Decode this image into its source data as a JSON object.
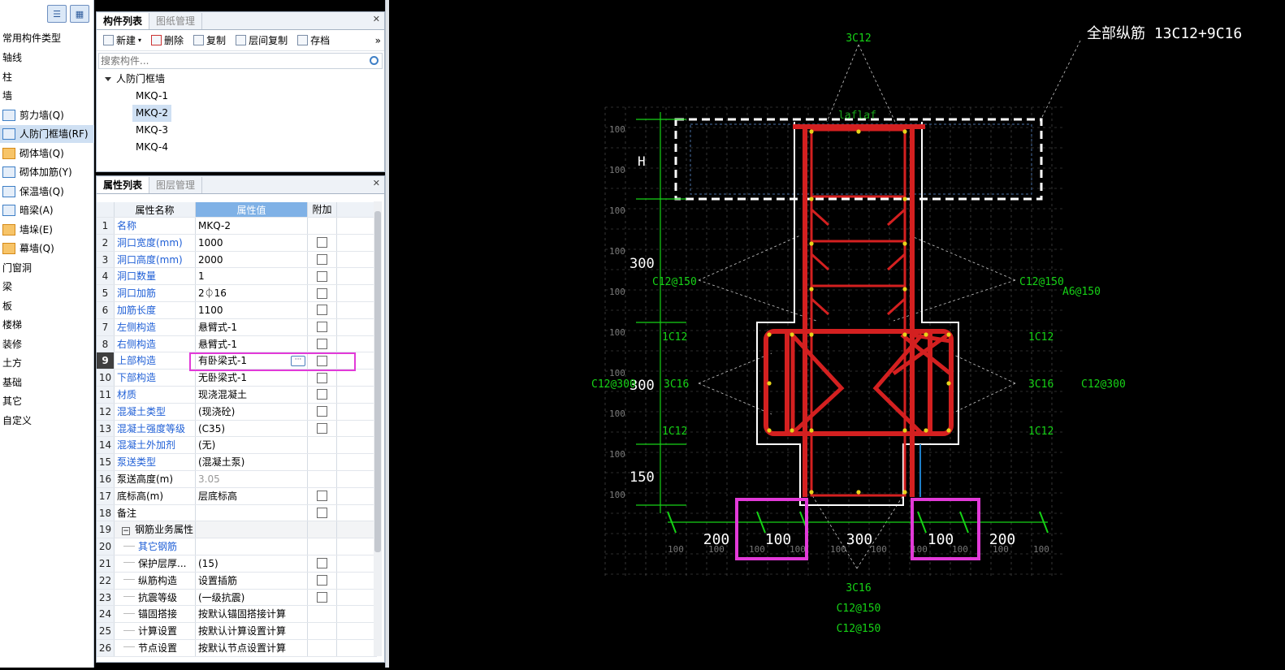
{
  "nav": {
    "title": "常用构件类型",
    "items": [
      {
        "label": "轴线"
      },
      {
        "label": "柱"
      },
      {
        "label": "墙"
      },
      {
        "label": "剪力墙(Q)",
        "icon": "shear-wall-icon"
      },
      {
        "label": "人防门框墙(RF)",
        "icon": "door-frame-wall-icon"
      },
      {
        "label": "砌体墙(Q)",
        "icon": "masonry-wall-icon"
      },
      {
        "label": "砌体加筋(Y)",
        "icon": "masonry-rebar-icon"
      },
      {
        "label": "保温墙(Q)",
        "icon": "insulation-wall-icon"
      },
      {
        "label": "暗梁(A)",
        "icon": "hidden-beam-icon"
      },
      {
        "label": "墙垛(E)",
        "icon": "wall-pier-icon"
      },
      {
        "label": "幕墙(Q)",
        "icon": "curtain-wall-icon"
      },
      {
        "label": "门窗洞"
      },
      {
        "label": "梁"
      },
      {
        "label": "板"
      },
      {
        "label": "楼梯"
      },
      {
        "label": "装修"
      },
      {
        "label": "土方"
      },
      {
        "label": "基础"
      },
      {
        "label": "其它"
      },
      {
        "label": "自定义"
      }
    ]
  },
  "comp": {
    "tabs": [
      "构件列表",
      "图纸管理"
    ],
    "toolbar": [
      "新建",
      "删除",
      "复制",
      "层间复制",
      "存档"
    ],
    "more": "»",
    "search_placeholder": "搜索构件...",
    "tree_root": "人防门框墙",
    "leaves": [
      "MKQ-1",
      "MKQ-2",
      "MKQ-3",
      "MKQ-4"
    ]
  },
  "prop": {
    "tabs": [
      "属性列表",
      "图层管理"
    ],
    "headers": [
      "属性名称",
      "属性值",
      "附加"
    ],
    "rows": [
      {
        "n": "1",
        "name": "名称",
        "val": "MKQ-2",
        "blue": true,
        "chk": false
      },
      {
        "n": "2",
        "name": "洞口宽度(mm)",
        "val": "1000",
        "blue": true,
        "chk": true
      },
      {
        "n": "3",
        "name": "洞口高度(mm)",
        "val": "2000",
        "blue": true,
        "chk": true
      },
      {
        "n": "4",
        "name": "洞口数量",
        "val": "1",
        "blue": true,
        "chk": true
      },
      {
        "n": "5",
        "name": "洞口加筋",
        "val": "2⏀16",
        "blue": true,
        "chk": true
      },
      {
        "n": "6",
        "name": "加筋长度",
        "val": "1100",
        "blue": true,
        "chk": true
      },
      {
        "n": "7",
        "name": "左侧构造",
        "val": "悬臂式-1",
        "blue": true,
        "chk": true
      },
      {
        "n": "8",
        "name": "右侧构造",
        "val": "悬臂式-1",
        "blue": true,
        "chk": true
      },
      {
        "n": "9",
        "name": "上部构造",
        "val": "有卧梁式-1",
        "blue": true,
        "chk": true,
        "selected": true
      },
      {
        "n": "10",
        "name": "下部构造",
        "val": "无卧梁式-1",
        "blue": true,
        "chk": true
      },
      {
        "n": "11",
        "name": "材质",
        "val": "现浇混凝土",
        "blue": true,
        "chk": true
      },
      {
        "n": "12",
        "name": "混凝土类型",
        "val": "(现浇砼)",
        "blue": true,
        "chk": true
      },
      {
        "n": "13",
        "name": "混凝土强度等级",
        "val": "(C35)",
        "blue": true,
        "chk": true
      },
      {
        "n": "14",
        "name": "混凝土外加剂",
        "val": "(无)",
        "blue": true,
        "chk": false
      },
      {
        "n": "15",
        "name": "泵送类型",
        "val": "(混凝土泵)",
        "blue": true,
        "chk": false
      },
      {
        "n": "16",
        "name": "泵送高度(m)",
        "val": "3.05",
        "blue": false,
        "grey": true,
        "chk": false
      },
      {
        "n": "17",
        "name": "底标高(m)",
        "val": "层底标高",
        "blue": false,
        "chk": true
      },
      {
        "n": "18",
        "name": "备注",
        "val": "",
        "blue": false,
        "chk": true
      },
      {
        "n": "19",
        "name": "钢筋业务属性",
        "val": "",
        "group": true,
        "chk": false
      },
      {
        "n": "20",
        "name": "其它钢筋",
        "val": "",
        "blue": true,
        "tree": true,
        "chk": false
      },
      {
        "n": "21",
        "name": "保护层厚...",
        "val": "(15)",
        "tree": true,
        "chk": true
      },
      {
        "n": "22",
        "name": "纵筋构造",
        "val": "设置插筋",
        "tree": true,
        "chk": true
      },
      {
        "n": "23",
        "name": "抗震等级",
        "val": "(一级抗震)",
        "tree": true,
        "chk": true
      },
      {
        "n": "24",
        "name": "锚固搭接",
        "val": "按默认锚固搭接计算",
        "tree": true,
        "chk": false
      },
      {
        "n": "25",
        "name": "计算设置",
        "val": "按默认计算设置计算",
        "tree": true,
        "chk": false
      },
      {
        "n": "26",
        "name": "节点设置",
        "val": "按默认节点设置计算",
        "tree": true,
        "chk": false
      }
    ]
  },
  "cad": {
    "title": "全部纵筋 13C12+9C16",
    "top_label": "3C12",
    "laflaf": "laflaf",
    "h_label": "H",
    "left_dims": [
      "300",
      "300",
      "150"
    ],
    "grid_label": "100",
    "rebar_left": [
      "C12@150",
      "1C12",
      "C12@300",
      "3C16",
      "1C12"
    ],
    "rebar_right": [
      "C12@150",
      "A6@150",
      "1C12",
      "3C16",
      "C12@300",
      "1C12"
    ],
    "bottom_dims": [
      "200",
      "100",
      "300",
      "100",
      "200"
    ],
    "bottom_labels": [
      "3C16",
      "C12@150",
      "C12@150"
    ],
    "colors": {
      "rebar": "#d42020",
      "dim": "#16d216",
      "white": "#ffffff",
      "grid": "#5a5a5a",
      "highlight": "#e23ad8"
    }
  }
}
